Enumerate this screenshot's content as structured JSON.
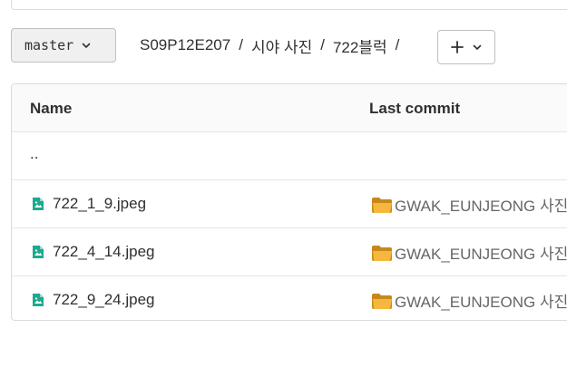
{
  "branch": {
    "name": "master"
  },
  "breadcrumb": [
    {
      "label": "S09P12E207"
    },
    {
      "label": "시야 사진"
    },
    {
      "label": "722블럭"
    }
  ],
  "breadcrumb_separator": "/",
  "add_button": {
    "icon": "plus-icon",
    "dropdown_icon": "chevron-down-icon"
  },
  "table": {
    "headers": {
      "name": "Name",
      "last_commit": "Last commit"
    },
    "parent_dir": "..",
    "rows": [
      {
        "name": "722_1_9.jpeg",
        "commit": "GWAK_EUNJEONG 사진"
      },
      {
        "name": "722_4_14.jpeg",
        "commit": "GWAK_EUNJEONG 사진"
      },
      {
        "name": "722_9_24.jpeg",
        "commit": "GWAK_EUNJEONG 사진"
      }
    ]
  },
  "colors": {
    "file_icon": "#1aaa8f",
    "folder_emoji": "#f0b429",
    "border": "#dbdbdb",
    "header_bg": "#fafafa"
  }
}
